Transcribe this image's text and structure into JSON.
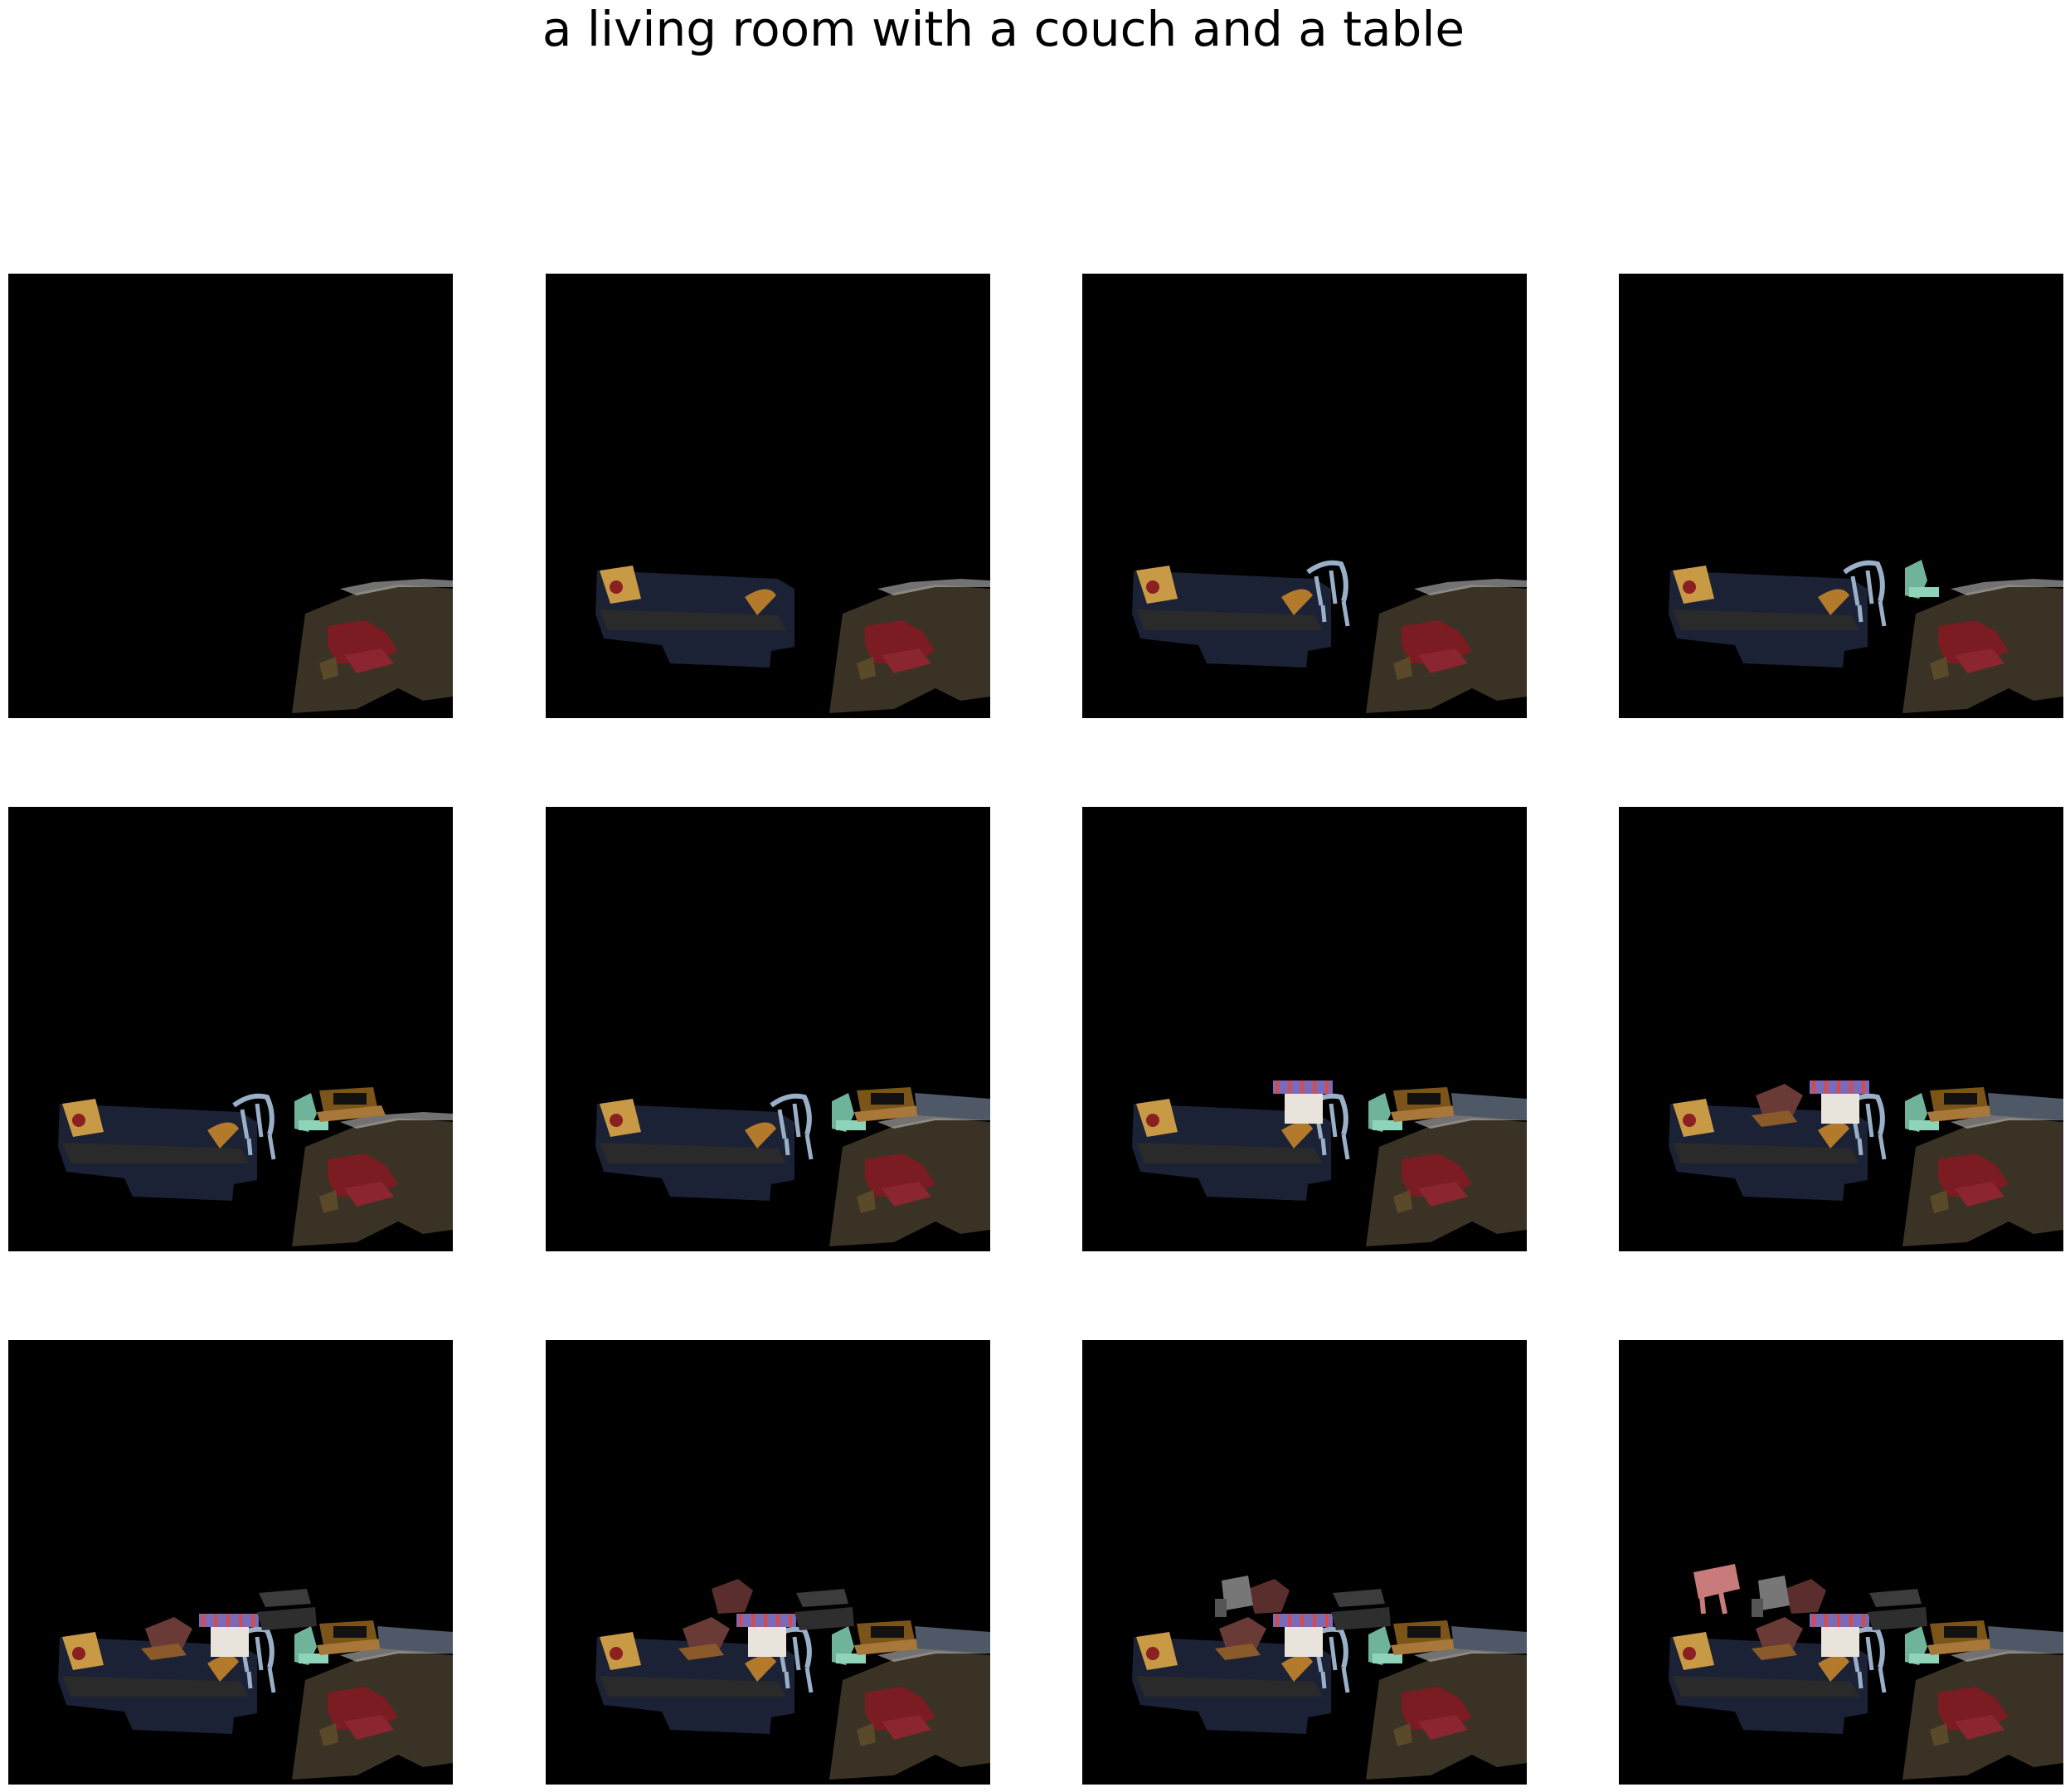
{
  "figure": {
    "title": "a living room with a couch and a table"
  },
  "panels": [
    {
      "index": 1,
      "step": 1,
      "objects": [
        "rug"
      ]
    },
    {
      "index": 2,
      "step": 2,
      "objects": [
        "rug",
        "couch"
      ]
    },
    {
      "index": 3,
      "step": 3,
      "objects": [
        "rug",
        "couch",
        "chair"
      ]
    },
    {
      "index": 4,
      "step": 4,
      "objects": [
        "rug",
        "couch",
        "chair",
        "armchair"
      ]
    },
    {
      "index": 5,
      "step": 5,
      "objects": [
        "rug",
        "couch",
        "chair",
        "armchair",
        "side-table"
      ]
    },
    {
      "index": 6,
      "step": 6,
      "objects": [
        "rug",
        "couch",
        "chair",
        "armchair",
        "side-table",
        "cabinet"
      ]
    },
    {
      "index": 7,
      "step": 7,
      "objects": [
        "rug",
        "couch",
        "chair",
        "armchair",
        "side-table",
        "cabinet",
        "striped-chair"
      ]
    },
    {
      "index": 8,
      "step": 8,
      "objects": [
        "rug",
        "couch",
        "chair",
        "armchair",
        "side-table",
        "cabinet",
        "striped-chair",
        "patterned-pillow"
      ]
    },
    {
      "index": 9,
      "step": 9,
      "objects": [
        "rug",
        "couch",
        "chair",
        "armchair",
        "side-table",
        "cabinet",
        "striped-chair",
        "patterned-pillow",
        "bench"
      ]
    },
    {
      "index": 10,
      "step": 10,
      "objects": [
        "rug",
        "couch",
        "chair",
        "armchair",
        "side-table",
        "cabinet",
        "striped-chair",
        "patterned-pillow",
        "bench",
        "patterned-chair"
      ]
    },
    {
      "index": 11,
      "step": 11,
      "objects": [
        "rug",
        "couch",
        "chair",
        "armchair",
        "side-table",
        "cabinet",
        "striped-chair",
        "patterned-pillow",
        "bench",
        "patterned-chair",
        "grey-armchair"
      ]
    },
    {
      "index": 12,
      "step": 12,
      "objects": [
        "rug",
        "couch",
        "chair",
        "armchair",
        "side-table",
        "cabinet",
        "striped-chair",
        "patterned-pillow",
        "bench",
        "patterned-chair",
        "grey-armchair",
        "pink-chair"
      ]
    }
  ],
  "colors": {
    "background": "#000000",
    "couch": "#1c2236",
    "rug": "#3a3224",
    "pillow_red": "#7a1c22",
    "pillow_yellow": "#c99a45",
    "chair_frame": "#9ab0c8",
    "armchair": "#6fb39a",
    "side_table": "#7a5418",
    "cabinet": "#4e5866",
    "striped": "#7a6ab8",
    "pattern_pillow": "#6a3a36",
    "bench": "#3c3c3c",
    "grey_armchair": "#777777",
    "pink_chair": "#c77b7b"
  }
}
